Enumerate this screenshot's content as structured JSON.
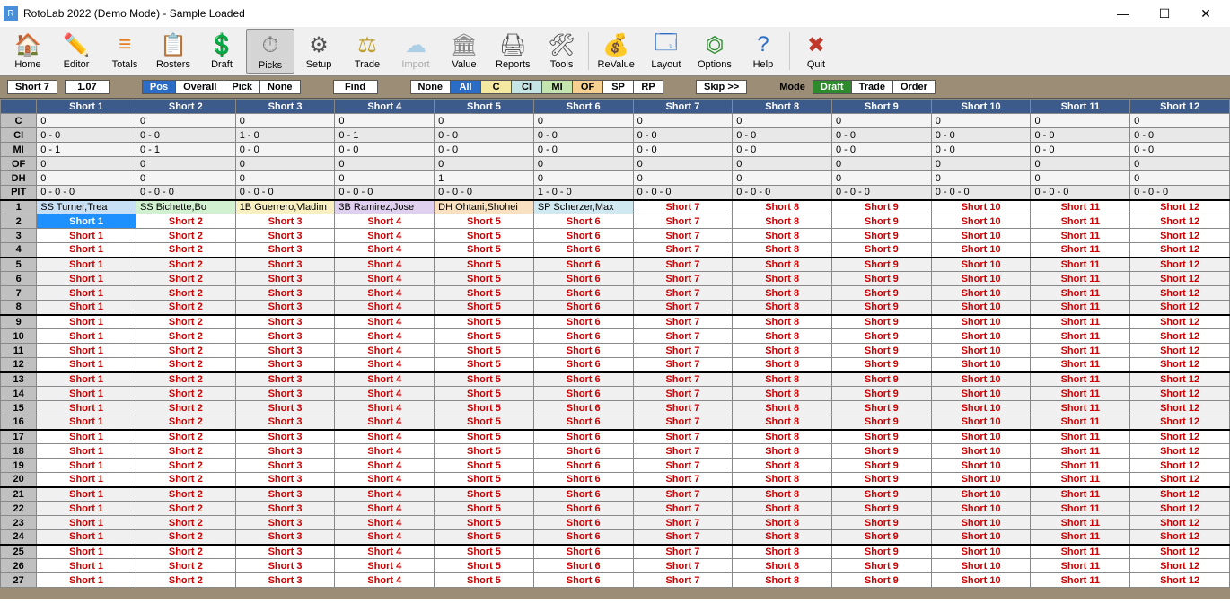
{
  "title": "RotoLab 2022 (Demo Mode) - Sample Loaded",
  "toolbar": [
    {
      "id": "home",
      "label": "Home",
      "icon": "🏠",
      "color": "#3a78c6"
    },
    {
      "id": "editor",
      "label": "Editor",
      "icon": "✏️",
      "color": "#e6a23c"
    },
    {
      "id": "totals",
      "label": "Totals",
      "icon": "≡",
      "color": "#e67e22"
    },
    {
      "id": "rosters",
      "label": "Rosters",
      "icon": "📋",
      "color": "#b88a5a"
    },
    {
      "id": "draft",
      "label": "Draft",
      "icon": "💲",
      "color": "#2d8a2d"
    },
    {
      "id": "picks",
      "label": "Picks",
      "icon": "⏱",
      "color": "#777",
      "active": true
    },
    {
      "id": "setup",
      "label": "Setup",
      "icon": "⚙",
      "color": "#555"
    },
    {
      "id": "trade",
      "label": "Trade",
      "icon": "⚖",
      "color": "#c0a030"
    },
    {
      "id": "import",
      "label": "Import",
      "icon": "☁",
      "color": "#4aa0d9",
      "disabled": true
    },
    {
      "id": "value",
      "label": "Value",
      "icon": "🏛",
      "color": "#888"
    },
    {
      "id": "reports",
      "label": "Reports",
      "icon": "🖨",
      "color": "#555"
    },
    {
      "id": "tools",
      "label": "Tools",
      "icon": "🛠",
      "color": "#555"
    },
    {
      "id": "sep1",
      "sep": true
    },
    {
      "id": "revalue",
      "label": "ReValue",
      "icon": "💰",
      "color": "#c0a030"
    },
    {
      "id": "layout",
      "label": "Layout",
      "icon": "🗔",
      "color": "#2a6cc6"
    },
    {
      "id": "options",
      "label": "Options",
      "icon": "⏣",
      "color": "#2d8a2d"
    },
    {
      "id": "help",
      "label": "Help",
      "icon": "?",
      "color": "#2a6cc6"
    },
    {
      "id": "sep2",
      "sep": true
    },
    {
      "id": "quit",
      "label": "Quit",
      "icon": "✖",
      "color": "#c0392b"
    }
  ],
  "filterbar": {
    "left": [
      "Short 7",
      "1.07"
    ],
    "group1": [
      {
        "t": "Pos",
        "cls": "blue"
      },
      {
        "t": "Overall"
      },
      {
        "t": "Pick"
      },
      {
        "t": "None"
      }
    ],
    "find": "Find",
    "group2": [
      {
        "t": "None"
      },
      {
        "t": "All",
        "cls": "blue"
      },
      {
        "t": "C",
        "cls": "ylw"
      },
      {
        "t": "CI",
        "cls": "cyn"
      },
      {
        "t": "MI",
        "cls": "grn2"
      },
      {
        "t": "OF",
        "cls": "orng"
      },
      {
        "t": "SP"
      },
      {
        "t": "RP"
      }
    ],
    "skip": "Skip >>",
    "mode_label": "Mode",
    "group3": [
      {
        "t": "Draft",
        "cls": "green"
      },
      {
        "t": "Trade"
      },
      {
        "t": "Order"
      }
    ]
  },
  "columns": [
    "Short 1",
    "Short 2",
    "Short 3",
    "Short 4",
    "Short 5",
    "Short 6",
    "Short 7",
    "Short 8",
    "Short 9",
    "Short 10",
    "Short 11",
    "Short 12"
  ],
  "summary_rows": [
    {
      "label": "C",
      "cells": [
        "0",
        "0",
        "0",
        "0",
        "0",
        "0",
        "0",
        "0",
        "0",
        "0",
        "0",
        "0"
      ]
    },
    {
      "label": "CI",
      "cells": [
        "0 - 0",
        "0 - 0",
        "1 - 0",
        "0 - 1",
        "0 - 0",
        "0 - 0",
        "0 - 0",
        "0 - 0",
        "0 - 0",
        "0 - 0",
        "0 - 0",
        "0 - 0"
      ]
    },
    {
      "label": "MI",
      "cells": [
        "0 - 1",
        "0 - 1",
        "0 - 0",
        "0 - 0",
        "0 - 0",
        "0 - 0",
        "0 - 0",
        "0 - 0",
        "0 - 0",
        "0 - 0",
        "0 - 0",
        "0 - 0"
      ]
    },
    {
      "label": "OF",
      "cells": [
        "0",
        "0",
        "0",
        "0",
        "0",
        "0",
        "0",
        "0",
        "0",
        "0",
        "0",
        "0"
      ]
    },
    {
      "label": "DH",
      "cells": [
        "0",
        "0",
        "0",
        "0",
        "1",
        "0",
        "0",
        "0",
        "0",
        "0",
        "0",
        "0"
      ]
    },
    {
      "label": "PIT",
      "cells": [
        "0 - 0 - 0",
        "0 - 0 - 0",
        "0 - 0 - 0",
        "0 - 0 - 0",
        "0 - 0 - 0",
        "1 - 0 - 0",
        "0 - 0 - 0",
        "0 - 0 - 0",
        "0 - 0 - 0",
        "0 - 0 - 0",
        "0 - 0 - 0",
        "0 - 0 - 0"
      ]
    }
  ],
  "pick_row1": [
    {
      "t": "SS Turner,Trea",
      "bg": "bg-lblue"
    },
    {
      "t": "SS Bichette,Bo",
      "bg": "bg-lgreen"
    },
    {
      "t": "1B Guerrero,Vladim",
      "bg": "bg-lylw"
    },
    {
      "t": "3B Ramirez,Jose",
      "bg": "bg-lpurp"
    },
    {
      "t": "DH Ohtani,Shohei",
      "bg": "bg-lorange"
    },
    {
      "t": "SP Scherzer,Max",
      "bg": "bg-lcyan"
    },
    {
      "t": "Short 7"
    },
    {
      "t": "Short 8"
    },
    {
      "t": "Short 9"
    },
    {
      "t": "Short 10"
    },
    {
      "t": "Short 11"
    },
    {
      "t": "Short 12"
    }
  ],
  "num_rows": 27,
  "selected": {
    "row": 2,
    "col": 0
  }
}
